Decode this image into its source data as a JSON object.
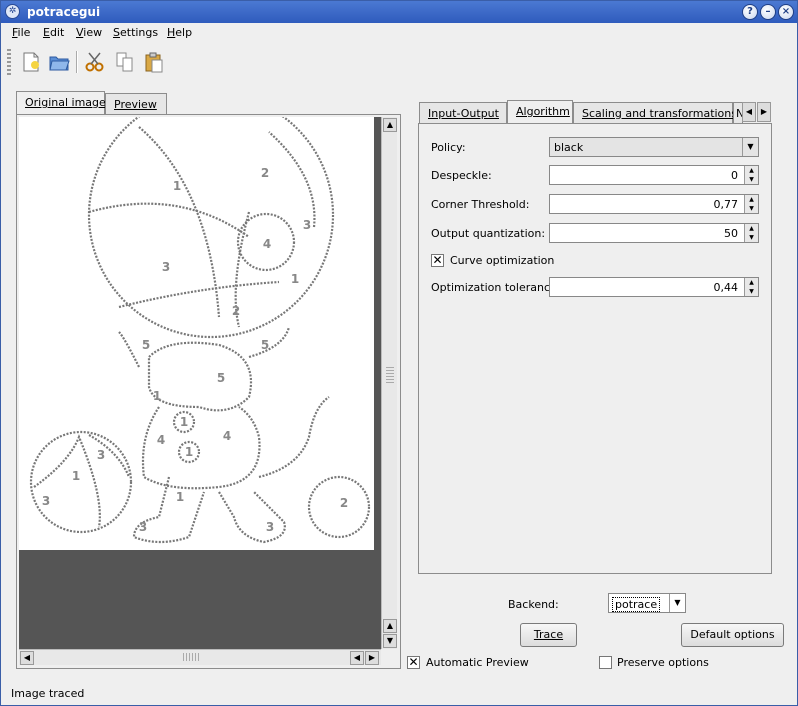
{
  "window": {
    "title": "potracegui"
  },
  "menu": [
    {
      "label": "File",
      "u": "F"
    },
    {
      "label": "Edit",
      "u": "E"
    },
    {
      "label": "View",
      "u": "V"
    },
    {
      "label": "Settings",
      "u": "S"
    },
    {
      "label": "Help",
      "u": "H"
    }
  ],
  "toolbar_icons": [
    "new-icon",
    "open-icon",
    "cut-icon",
    "copy-icon",
    "paste-icon"
  ],
  "left_tabs": {
    "original": "Original image",
    "preview": "Preview"
  },
  "right_tabs": {
    "input_output": "Input-Output",
    "algorithm": "Algorithm",
    "scaling": "Scaling and transformations",
    "more": "N"
  },
  "form": {
    "policy": {
      "label": "Policy:",
      "value": "black"
    },
    "despeckle": {
      "label": "Despeckle:",
      "value": "0"
    },
    "corner": {
      "label": "Corner Threshold:",
      "value": "0,77"
    },
    "quant": {
      "label": "Output quantization:",
      "value": "50"
    },
    "curve": {
      "label": "Curve optimization",
      "checked": true
    },
    "tolerance": {
      "label": "Optimization tolerance:",
      "value": "0,44"
    }
  },
  "backend": {
    "label": "Backend:",
    "value": "potrace"
  },
  "buttons": {
    "trace": "Trace",
    "default": "Default options"
  },
  "auto_preview": {
    "label": "Automatic Preview",
    "checked": true
  },
  "preserve": {
    "label": "Preserve options",
    "checked": false
  },
  "image_numbers": [
    "1",
    "2",
    "3",
    "4",
    "3",
    "1",
    "2",
    "5",
    "5",
    "5",
    "4",
    "1",
    "1",
    "4",
    "1",
    "3",
    "3",
    "1",
    "1",
    "3",
    "3",
    "2"
  ],
  "status": "Image traced"
}
